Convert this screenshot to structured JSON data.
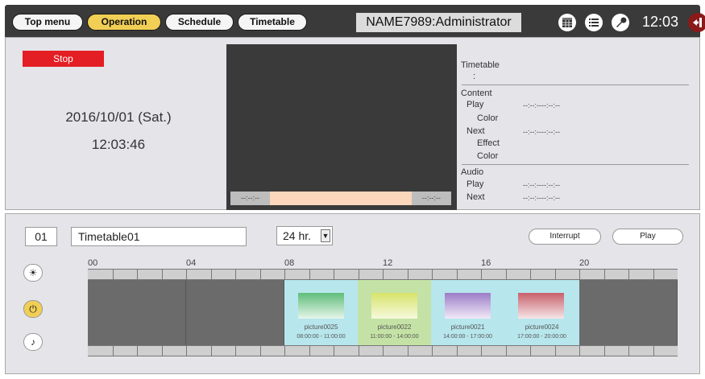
{
  "nav": {
    "top_menu": "Top menu",
    "operation": "Operation",
    "schedule": "Schedule",
    "timetable": "Timetable"
  },
  "header": {
    "title": "NAME7989:Administrator",
    "clock": "12:03",
    "icons": [
      "calendar-icon",
      "list-icon",
      "wrench-icon",
      "exit-icon"
    ]
  },
  "status": {
    "stop_label": "Stop",
    "date": "2016/10/01 (Sat.)",
    "time": "12:03:46"
  },
  "preview": {
    "left_time": "--:--:--",
    "right_time": "--:--:--"
  },
  "info": {
    "timetable_label": "Timetable",
    "timetable_value": ":",
    "content_label": "Content",
    "play_label": "Play",
    "play_value": "--:--:----:--:--",
    "color_label": "Color",
    "next_label": "Next",
    "next_value": "--:--:----:--:--",
    "effect_label": "Effect",
    "color2_label": "Color",
    "audio_label": "Audio",
    "audio_play_label": "Play",
    "audio_play_value": "--:--:----:--:--",
    "audio_next_label": "Next",
    "audio_next_value": "--:--:----:--:--"
  },
  "timetable": {
    "number": "01",
    "name": "Timetable01",
    "mode": "24 hr.",
    "interrupt_label": "Interrupt",
    "play_label": "Play",
    "hours": [
      "00",
      "04",
      "08",
      "12",
      "16",
      "20"
    ],
    "items": [
      {
        "name": "picture0025",
        "time": "08:00:00 - 11:00:00"
      },
      {
        "name": "picture0022",
        "time": "11:00:00 - 14:00:00"
      },
      {
        "name": "picture0021",
        "time": "14:00:00 - 17:00:00"
      },
      {
        "name": "picture0024",
        "time": "17:00:00 - 20:00:00"
      }
    ]
  },
  "colors": {
    "accent": "#f1cf55",
    "stop": "#e31e24",
    "selected_item": "#c4e2a5",
    "item_bg": "#b7e6ec"
  }
}
